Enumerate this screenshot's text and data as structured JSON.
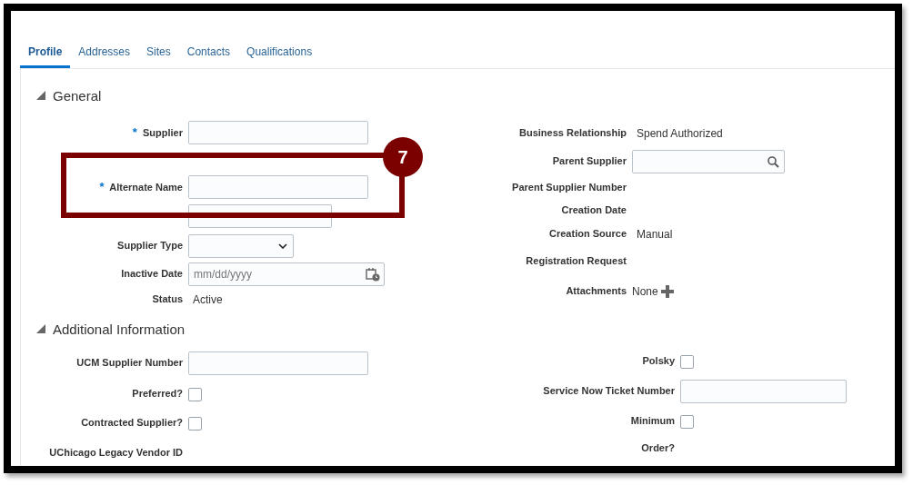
{
  "tabs": [
    {
      "label": "Profile",
      "selected": true
    },
    {
      "label": "Addresses",
      "selected": false
    },
    {
      "label": "Sites",
      "selected": false
    },
    {
      "label": "Contacts",
      "selected": false
    },
    {
      "label": "Qualifications",
      "selected": false
    }
  ],
  "sections": [
    {
      "title": "General",
      "expanded": true,
      "left": [
        {
          "kind": "text",
          "label": "Supplier",
          "marker": "*"
        },
        {
          "kind": "spacer"
        },
        {
          "kind": "text",
          "label": "Alternate Name",
          "marker": "*"
        },
        {
          "kind": "short_text"
        },
        {
          "kind": "select",
          "label": "Supplier Type"
        },
        {
          "kind": "date",
          "label": "Inactive Date",
          "placeholder": "mm/dd/yyyy"
        },
        {
          "kind": "readonly",
          "label": "Status",
          "value": "Active"
        }
      ],
      "right": [
        {
          "kind": "readonly",
          "label": "Business Relationship",
          "value": "Spend Authorized"
        },
        {
          "kind": "search",
          "label": "Parent Supplier"
        },
        {
          "kind": "readonly",
          "label": "Parent Supplier Number"
        },
        {
          "kind": "readonly",
          "label": "Creation Date"
        },
        {
          "kind": "readonly",
          "label": "Creation Source",
          "value": "Manual"
        },
        {
          "kind": "readonly",
          "label": "Registration Request"
        },
        {
          "kind": "attachments",
          "label": "Attachments",
          "value": "None"
        }
      ]
    },
    {
      "title": "Additional Information",
      "expanded": true,
      "left": [
        {
          "kind": "text",
          "label": "UCM Supplier Number"
        },
        {
          "kind": "checkbox",
          "label": "Preferred?",
          "checked": false
        },
        {
          "kind": "checkbox",
          "label": "Contracted Supplier?",
          "checked": false
        },
        {
          "kind": "readonly",
          "label": "UChicago Legacy Vendor ID"
        }
      ],
      "right": [
        {
          "kind": "checkbox",
          "label": "Polsky",
          "checked": false
        },
        {
          "kind": "text",
          "label": "Service Now Ticket Number"
        },
        {
          "kind": "checkbox",
          "label": "Minimum",
          "checked": false
        },
        {
          "kind": "readonly",
          "label": "Order?"
        }
      ]
    }
  ],
  "annotation": {
    "number": "7"
  }
}
